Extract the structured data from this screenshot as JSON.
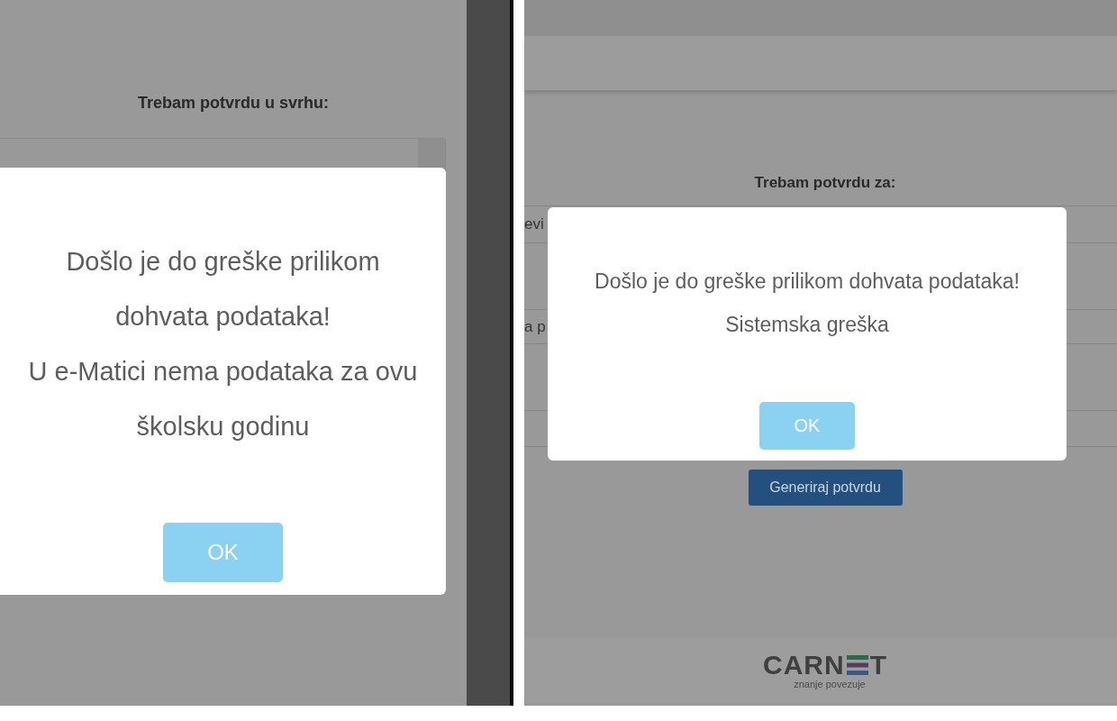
{
  "left_screen": {
    "title": "Trebam potvrdu u svrhu:",
    "dialog": {
      "message_lines": [
        "Došlo je do greške prilikom",
        "dohvata podataka!",
        "U e-Matici nema podataka za ovu",
        "školsku godinu"
      ],
      "button": "OK"
    }
  },
  "right_screen": {
    "title": "Trebam potvrdu za:",
    "field_rows": [
      "evi",
      "a p"
    ],
    "generate_button": "Generiraj potvrdu",
    "dialog": {
      "message_lines": [
        "Došlo je do greške prilikom dohvata podataka!",
        "Sistemska greška"
      ],
      "button": "OK"
    },
    "footer": {
      "logo_parts": [
        "CARN",
        "T"
      ],
      "tagline": "znanje povezuje"
    }
  }
}
